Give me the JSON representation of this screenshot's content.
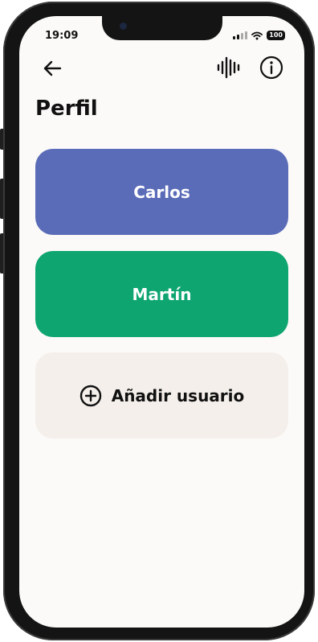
{
  "status_bar": {
    "time": "19:09",
    "battery": "100"
  },
  "header": {
    "back_icon": "arrow-left-icon",
    "voice_icon": "audio-waveform-icon",
    "info_icon": "info-circle-icon"
  },
  "page": {
    "title": "Perfil"
  },
  "profiles": [
    {
      "name": "Carlos",
      "color": "#5a6cb8"
    },
    {
      "name": "Martín",
      "color": "#0ea571"
    }
  ],
  "add_user": {
    "label": "Añadir usuario",
    "icon": "plus-circle-icon",
    "color": "#f4efea"
  }
}
